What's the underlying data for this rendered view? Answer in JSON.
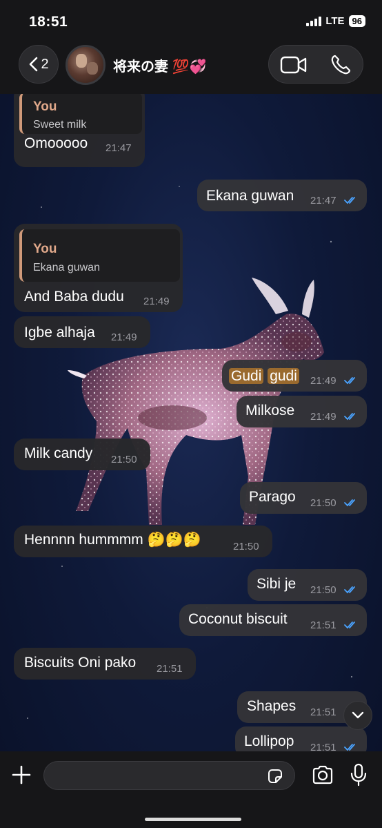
{
  "status": {
    "time": "18:51",
    "network": "LTE",
    "battery": "96"
  },
  "header": {
    "back_count": "2",
    "contact_name": "将来の妻 💯💞"
  },
  "messages": [
    {
      "quote_author": "You",
      "quote_text": "Sweet milk",
      "text": "Omooooo",
      "time": "21:47"
    },
    {
      "text": "Ekana guwan",
      "time": "21:47"
    },
    {
      "quote_author": "You",
      "quote_text": "Ekana guwan",
      "text": "And Baba dudu",
      "time": "21:49"
    },
    {
      "text": "Igbe alhaja",
      "time": "21:49"
    },
    {
      "text_part1": "Gudi",
      "text_part2": "gudi",
      "time": "21:49"
    },
    {
      "text": "Milkose",
      "time": "21:49"
    },
    {
      "text": "Milk candy",
      "time": "21:50"
    },
    {
      "text": "Parago",
      "time": "21:50"
    },
    {
      "text": "Hennnn hummmm 🤔🤔🤔",
      "time": "21:50"
    },
    {
      "text": "Sibi je",
      "time": "21:50"
    },
    {
      "text": "Coconut biscuit",
      "time": "21:51"
    },
    {
      "text": "Biscuits Oni pako",
      "time": "21:51"
    },
    {
      "text": "Shapes",
      "time": "21:51"
    },
    {
      "text": "Lollipop",
      "time": "21:51"
    }
  ],
  "colors": {
    "tick_read": "#4aa3ff",
    "quote_accent": "#d09a7a",
    "highlight": "#9a6a2e"
  },
  "icons": [
    "chevron-left-icon",
    "video-icon",
    "phone-icon",
    "chevron-down-icon",
    "plus-icon",
    "sticker-icon",
    "camera-icon",
    "mic-icon",
    "double-check-icon"
  ]
}
